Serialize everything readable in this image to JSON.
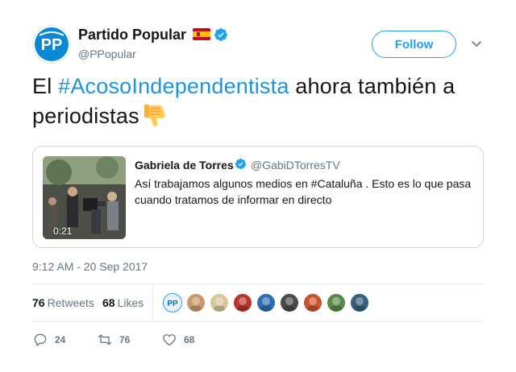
{
  "author": {
    "display_name": "Partido Popular",
    "handle": "@PPopular",
    "avatar_text": "PP",
    "follow_label": "Follow"
  },
  "tweet": {
    "text_before": "El ",
    "hashtag": "#AcosoIndependentista",
    "text_after": " ahora también a periodistas",
    "emoji": "thumbs-down"
  },
  "quoted": {
    "display_name": "Gabriela de Torres",
    "handle": "@GabiDTorresTV",
    "text": "Así trabajamos algunos medios en #Cataluña . Esto es lo que pasa cuando tratamos de informar en directo",
    "video_duration": "0:21"
  },
  "timestamp": "9:12 AM - 20 Sep 2017",
  "stats": {
    "retweets_count": "76",
    "retweets_label": "Retweets",
    "likes_count": "68",
    "likes_label": "Likes"
  },
  "likers": [
    {
      "name": "PP",
      "color": "#e8f2fb"
    },
    {
      "name": "liker-2",
      "color": "#c89a6a"
    },
    {
      "name": "liker-3",
      "color": "#d9c79b"
    },
    {
      "name": "liker-4",
      "color": "#b8332a"
    },
    {
      "name": "liker-5",
      "color": "#2f6fb0"
    },
    {
      "name": "liker-6",
      "color": "#4a4a4a"
    },
    {
      "name": "liker-7",
      "color": "#c8552c"
    },
    {
      "name": "liker-8",
      "color": "#5a8a4a"
    },
    {
      "name": "liker-9",
      "color": "#36607a"
    }
  ],
  "actions": {
    "replies": "24",
    "retweets": "76",
    "likes": "68"
  },
  "colors": {
    "accent": "#1da1f2",
    "hashtag": "#1b95e0",
    "muted": "#657786",
    "text": "#14171a"
  }
}
